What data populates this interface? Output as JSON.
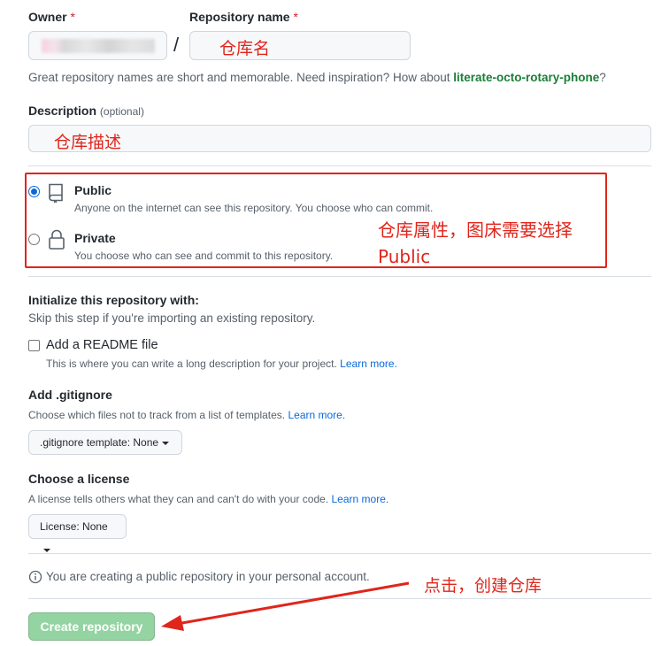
{
  "owner": {
    "label": "Owner",
    "required_mark": "*"
  },
  "repo_name": {
    "label": "Repository name",
    "required_mark": "*",
    "separator": "/",
    "annotation": "仓库名"
  },
  "name_hint": {
    "prefix": "Great repository names are short and memorable. Need inspiration? How about ",
    "suggestion": "literate-octo-rotary-phone",
    "suffix": "?"
  },
  "description": {
    "label": "Description",
    "optional": "(optional)",
    "annotation": "仓库描述"
  },
  "visibility": {
    "public_title": "Public",
    "public_desc": "Anyone on the internet can see this repository. You choose who can commit.",
    "private_title": "Private",
    "private_desc": "You choose who can see and commit to this repository.",
    "annotation_line1": "仓库属性，图床需要选择",
    "annotation_line2": "Public",
    "selected": "Public"
  },
  "init": {
    "title": "Initialize this repository with:",
    "hint": "Skip this step if you're importing an existing repository.",
    "readme_label": "Add a README file",
    "readme_desc": "This is where you can write a long description for your project.",
    "readme_link": "Learn more."
  },
  "gitignore": {
    "title": "Add .gitignore",
    "hint": "Choose which files not to track from a list of templates.",
    "link": "Learn more.",
    "button": ".gitignore template: None"
  },
  "license": {
    "title": "Choose a license",
    "hint": "A license tells others what they can and can't do with your code.",
    "link": "Learn more.",
    "button": "License: None"
  },
  "notice": {
    "text": "You are creating a public repository in your personal account.",
    "annotation": "点击，创建仓库"
  },
  "create_button": "Create repository",
  "colors": {
    "annotation_red": "#e0251b",
    "button_green_disabled": "#94d3a2",
    "link_blue": "#0969da",
    "suggestion_green": "#1a7f37"
  }
}
